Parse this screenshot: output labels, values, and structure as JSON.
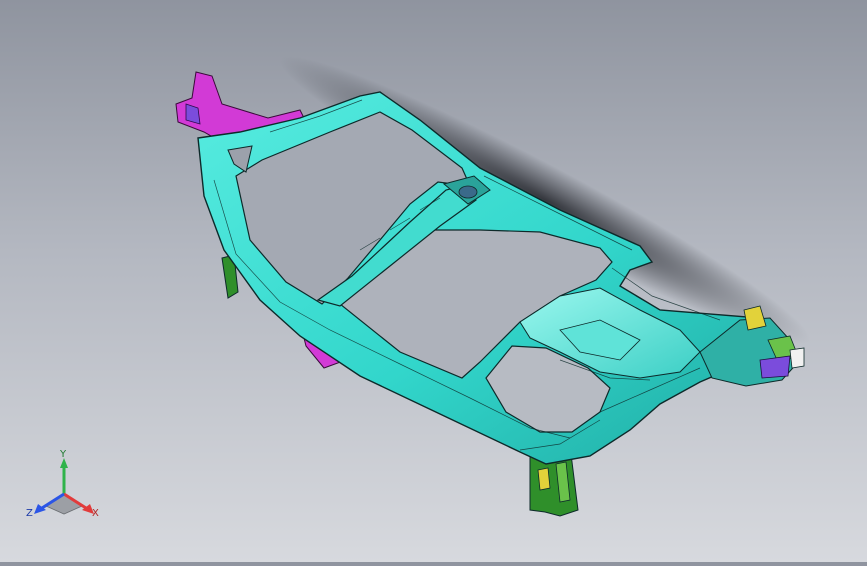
{
  "viewport": {
    "background_top": "#8f949f",
    "background_bottom": "#d7d9de",
    "model_colors": {
      "frame": "#38e0d2",
      "frame_dark": "#1e9a93",
      "magenta": "#d23ad6",
      "purple": "#7b4cdc",
      "green": "#2f8f2a",
      "yellow": "#e2d23a",
      "outline": "#0d2a2a"
    }
  },
  "triad": {
    "x_label": "X",
    "y_label": "Y",
    "z_label": "Z",
    "x_color": "#e23b3b",
    "y_color": "#2fb34a",
    "z_color": "#2b55e6"
  }
}
